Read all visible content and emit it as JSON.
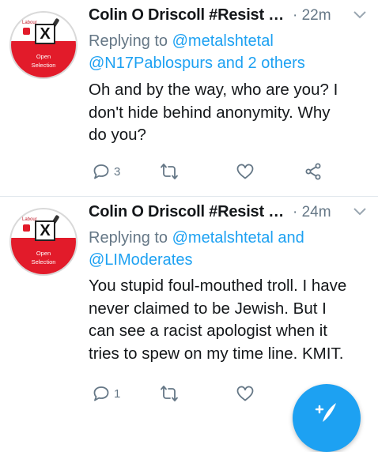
{
  "tweets": [
    {
      "author": "Colin O Driscoll #Resist …",
      "time": "· 22m",
      "replying_label": "Replying to ",
      "replying_line1_handle": "@metalshtetal",
      "replying_line2": "@N17Pablospurs and 2 others",
      "text_lines": [
        "Oh and by the way, who are you? I",
        "don't hide behind anonymity. Why",
        "do you?"
      ],
      "reply_count": "3",
      "avatar": {
        "small_label": "Labour",
        "mark": "X",
        "label_1": "Open",
        "label_2": "Selection"
      }
    },
    {
      "author": "Colin O Driscoll #Resist …",
      "time": "· 24m",
      "replying_label": "Replying to ",
      "replying_line1_handle": "@metalshtetal and",
      "replying_line2": "@LIModerates",
      "text_lines": [
        "You stupid foul-mouthed troll. I have",
        "never claimed to be Jewish. But I",
        "can see a racist apologist when it",
        "tries to spew on my time line. KMIT."
      ],
      "reply_count": "1",
      "avatar": {
        "small_label": "Labour",
        "mark": "X",
        "label_1": "Open",
        "label_2": "Selection"
      }
    }
  ],
  "icons": {
    "reply": "reply-icon",
    "retweet": "retweet-icon",
    "like": "like-icon",
    "share": "share-icon",
    "menu": "chevron-down-icon",
    "compose": "compose-icon"
  },
  "colors": {
    "accent": "#1da1f2",
    "muted": "#657786",
    "text": "#14171a",
    "logo_red": "#e21b2a"
  }
}
